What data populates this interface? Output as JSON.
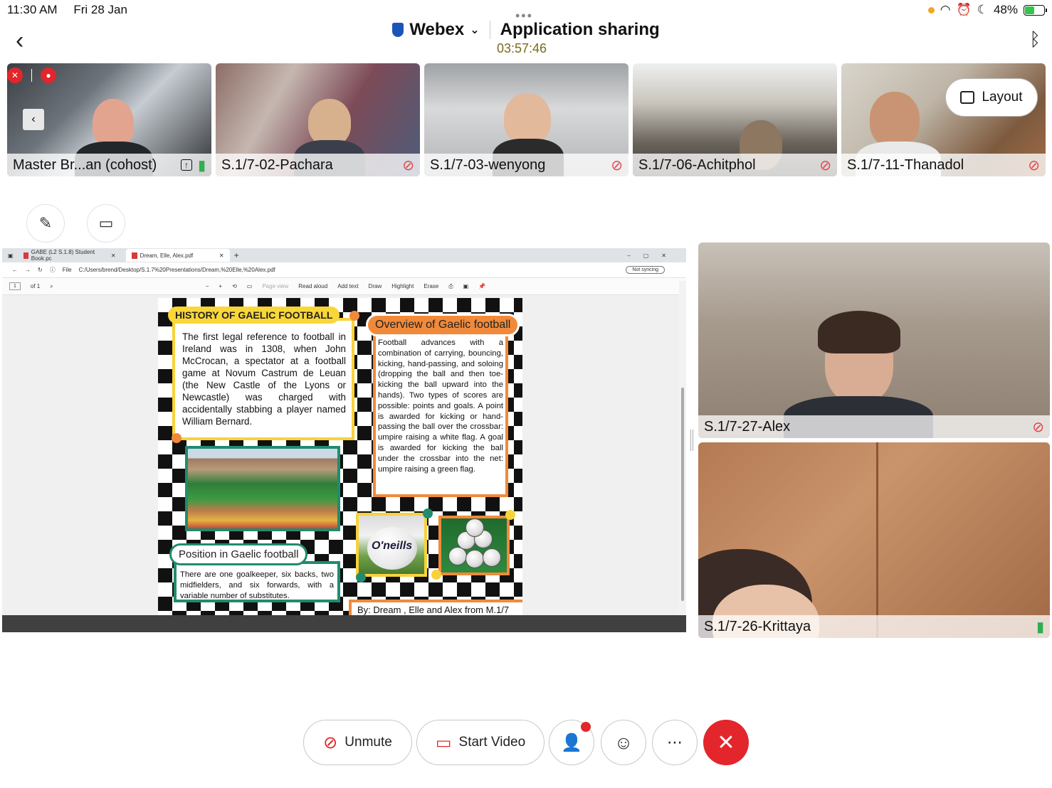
{
  "status_bar": {
    "time": "11:30 AM",
    "date": "Fri 28 Jan",
    "battery": "48%"
  },
  "header": {
    "app_name": "Webex",
    "title": "Application sharing",
    "timer": "03:57:46"
  },
  "participants": [
    {
      "name": "Master Br...an (cohost)",
      "muted": false
    },
    {
      "name": "S.1/7-02-Pachara",
      "muted": true
    },
    {
      "name": "S.1/7-03-wenyong",
      "muted": true
    },
    {
      "name": "S.1/7-06-Achitphol",
      "muted": true
    },
    {
      "name": "S.1/7-11-Thanadol",
      "muted": true
    }
  ],
  "layout_button": {
    "label": "Layout"
  },
  "shared_screen": {
    "tabs": [
      {
        "label": "GABE (L2 S.1.8) Student Book.pc"
      },
      {
        "label": "Dream, Elle, Alex.pdf"
      }
    ],
    "address": {
      "file_label": "File",
      "url": "C:/Users/brend/Desktop/S.1.7%20Presentations/Dream,%20Elle,%20Alex.pdf",
      "sync": "Not syncing"
    },
    "toolbar": {
      "page": "1",
      "of": "of 1",
      "page_view": "Page view",
      "read_aloud": "Read aloud",
      "add_text": "Add text",
      "draw": "Draw",
      "highlight": "Highlight",
      "erase": "Erase"
    },
    "pdf": {
      "history_title": "HISTORY OF GAELIC FOOTBALL",
      "history_text": "The first legal reference to football in Ireland was in 1308, when John McCrocan, a spectator at a football game at Novum Castrum de Leuan (the New Castle of the Lyons or Newcastle) was charged with accidentally stabbing a player named William Bernard.",
      "overview_title": "Overview of Gaelic football",
      "overview_text": "Football advances with a combination of carrying, bouncing, kicking, hand-passing, and soloing (dropping the ball and then toe-kicking the ball upward into the hands). Two types of scores are possible: points and goals. A point is awarded for kicking or hand-passing the ball over the crossbar: umpire raising a white flag. A goal is awarded for kicking the ball under the crossbar into the net: umpire raising a green flag.",
      "position_title": "Position in Gaelic football",
      "position_text": "There are one goalkeeper, six backs, two midfielders, and six forwards, with a variable number of substitutes.",
      "ball_brand": "O'neills",
      "credits": "By: Dream , Elle and Alex from M.1/7"
    }
  },
  "side_videos": [
    {
      "name": "S.1/7-27-Alex",
      "muted": true
    },
    {
      "name": "S.1/7-26-Krittaya",
      "muted": false
    }
  ],
  "controls": {
    "unmute": "Unmute",
    "start_video": "Start Video"
  },
  "icons": {
    "back": "chevron-left-icon",
    "bluetooth": "bluetooth-icon",
    "annotate": "pen-icon",
    "share": "screen-share-icon",
    "participants": "participants-icon",
    "reactions": "emoji-icon",
    "more": "ellipsis-icon",
    "end": "close-icon"
  },
  "colors": {
    "accent_red": "#e2262b",
    "mic_green": "#2fae4f",
    "timer": "#7a6a1c"
  }
}
